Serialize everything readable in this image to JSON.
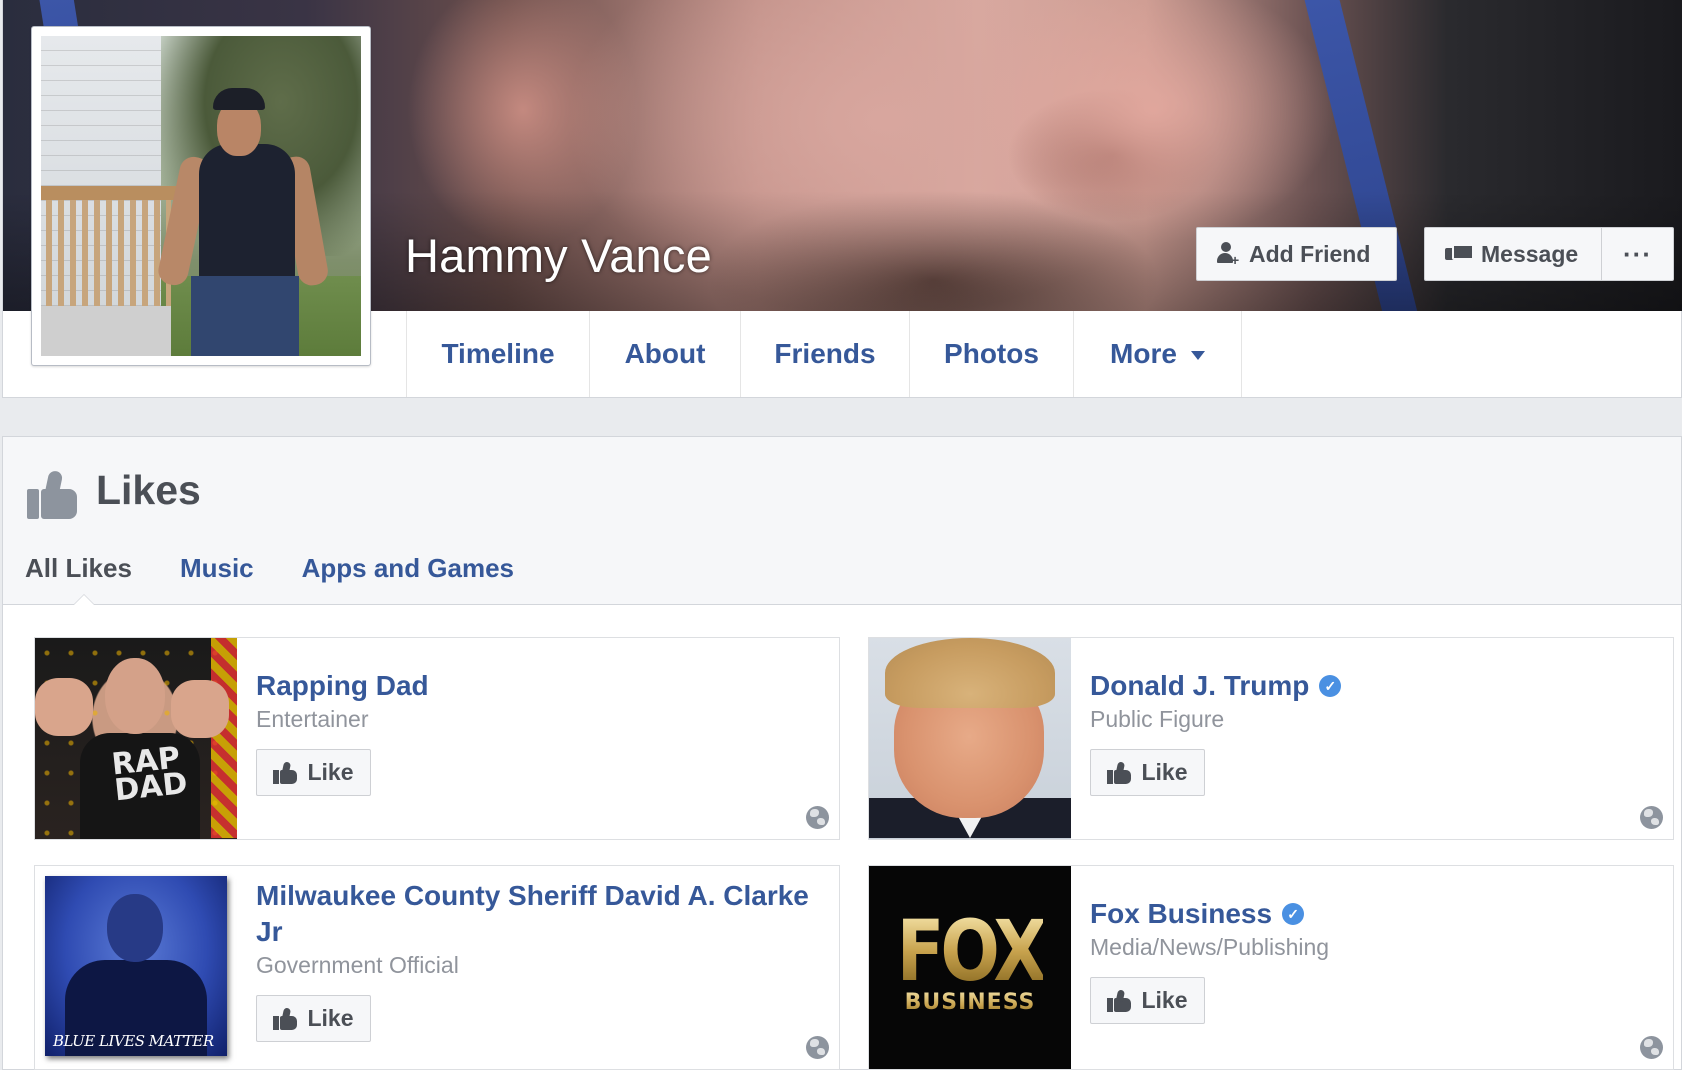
{
  "profile": {
    "name": "Hammy Vance",
    "actions": {
      "add_friend": "Add Friend",
      "message": "Message",
      "more": "···"
    },
    "nav": [
      {
        "label": "Timeline"
      },
      {
        "label": "About"
      },
      {
        "label": "Friends"
      },
      {
        "label": "Photos"
      },
      {
        "label": "More"
      }
    ]
  },
  "likes": {
    "title": "Likes",
    "tabs": [
      {
        "label": "All Likes",
        "active": true
      },
      {
        "label": "Music",
        "active": false
      },
      {
        "label": "Apps and Games",
        "active": false
      }
    ],
    "items": [
      {
        "name": "Rapping Dad",
        "category": "Entertainer",
        "verified": false,
        "button": "Like",
        "image_text": "RAP DAD"
      },
      {
        "name": "Donald J. Trump",
        "category": "Public Figure",
        "verified": true,
        "button": "Like"
      },
      {
        "name": "Milwaukee County Sheriff David A. Clarke Jr",
        "category": "Government Official",
        "verified": false,
        "button": "Like",
        "image_text": "BLUE LIVES MATTER"
      },
      {
        "name": "Fox Business",
        "category": "Media/News/Publishing",
        "verified": true,
        "button": "Like",
        "image_text": [
          "FOX",
          "BUSINESS"
        ]
      }
    ]
  },
  "colors": {
    "link": "#365899",
    "text_dark": "#4b4f56",
    "text_muted": "#90949c",
    "page_bg": "#e9ebee",
    "verified": "#4a90e2"
  }
}
